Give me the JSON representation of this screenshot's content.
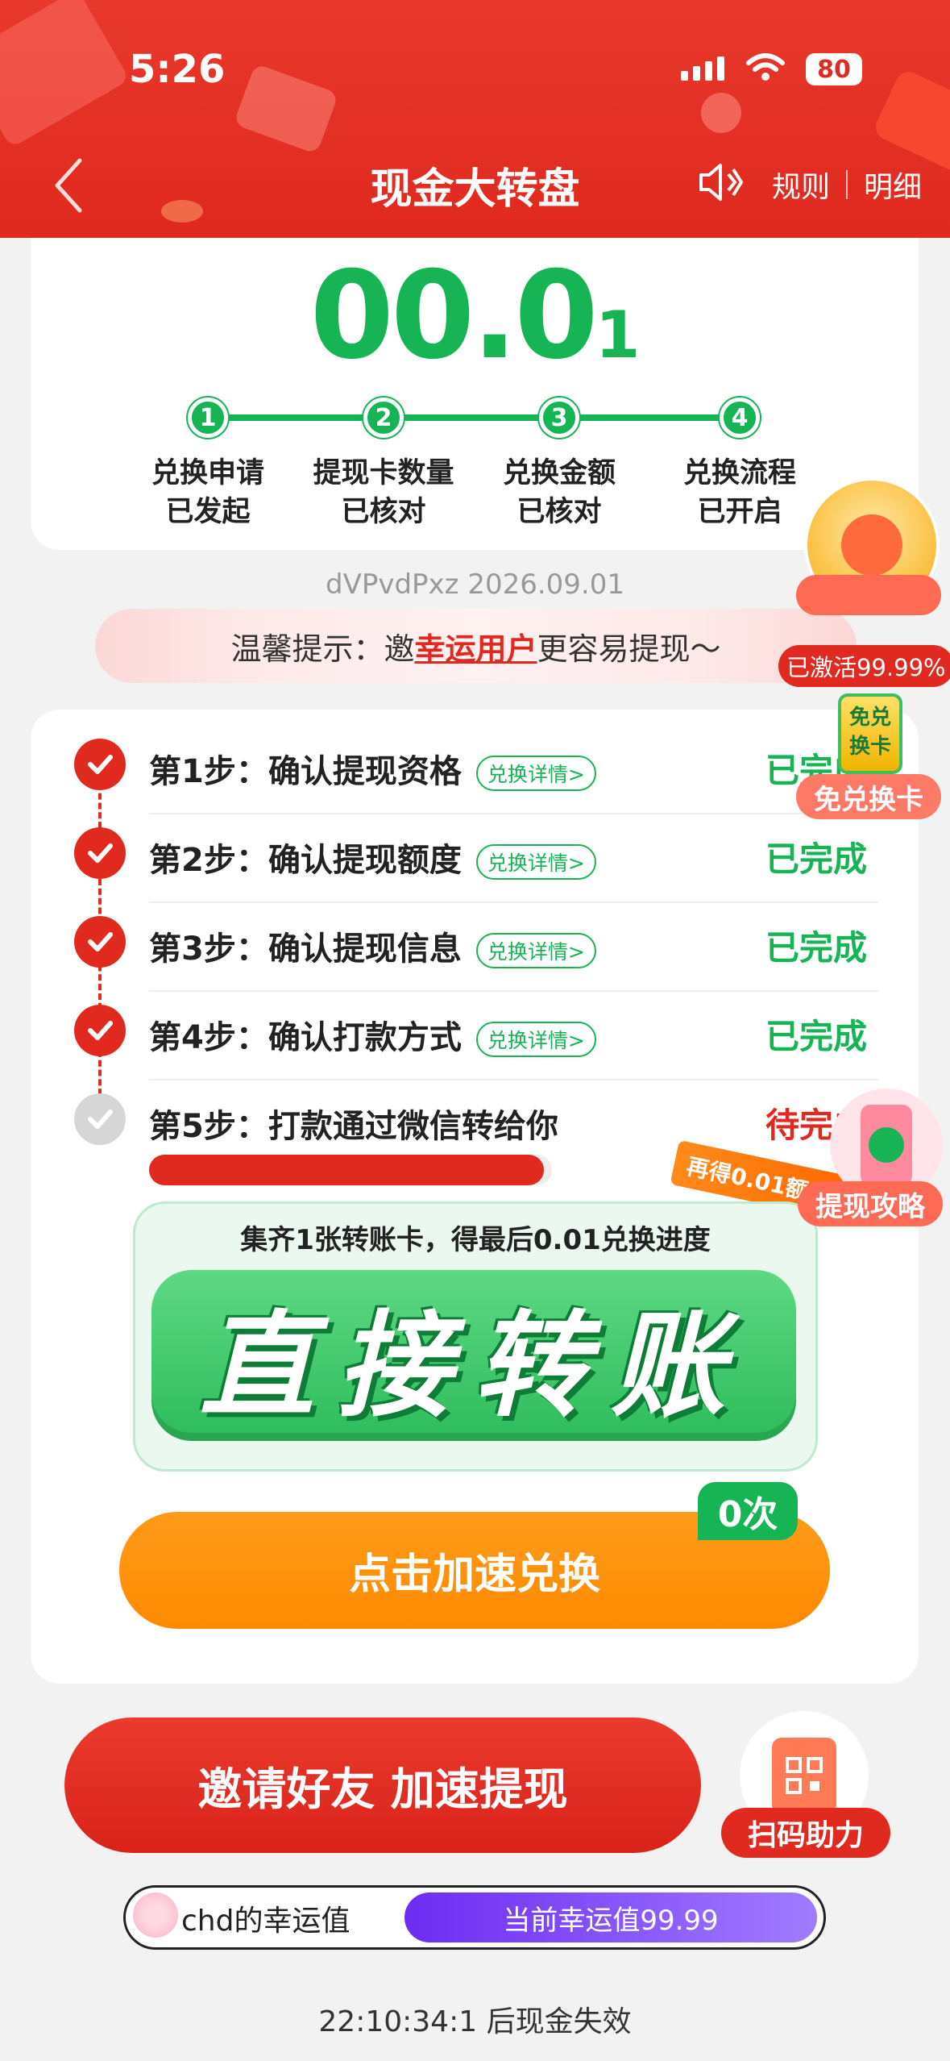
{
  "status_bar": {
    "time": "5:26",
    "battery": "80"
  },
  "header": {
    "title": "现金大转盘",
    "rules": "规则",
    "details": "明细"
  },
  "amount": {
    "main": "00.0",
    "tail": "1"
  },
  "progress_steps": [
    {
      "num": "1",
      "line1": "兑换申请",
      "line2": "已发起"
    },
    {
      "num": "2",
      "line1": "提现卡数量",
      "line2": "已核对"
    },
    {
      "num": "3",
      "line1": "兑换金额",
      "line2": "已核对"
    },
    {
      "num": "4",
      "line1": "兑换流程",
      "line2": "已开启"
    }
  ],
  "code_line": "dVPvdPxz 2026.09.01",
  "tip": {
    "prefix": "温馨提示：邀",
    "highlight": "幸运用户",
    "suffix": "更容易提现～"
  },
  "steps": [
    {
      "text": "第1步：确认提现资格",
      "tag": "兑换详情>",
      "status": "已完成",
      "done": true
    },
    {
      "text": "第2步：确认提现额度",
      "tag": "兑换详情>",
      "status": "已完成",
      "done": true
    },
    {
      "text": "第3步：确认提现信息",
      "tag": "兑换详情>",
      "status": "已完成",
      "done": true
    },
    {
      "text": "第4步：确认打款方式",
      "tag": "兑换详情>",
      "status": "已完成",
      "done": true
    },
    {
      "text": "第5步：打款通过微信转给你",
      "tag": "",
      "status": "待完成",
      "done": false
    }
  ],
  "progress": {
    "fraction": 0.98
  },
  "bonus_tag": "再得0.01额度",
  "transfer": {
    "title": "集齐1张转账卡，得最后0.01兑换进度",
    "button": "直接转账"
  },
  "accelerate": {
    "count": "0次",
    "label": "点击加速兑换"
  },
  "invite": {
    "label": "邀请好友 加速提现"
  },
  "scan": {
    "label": "扫码助力"
  },
  "luck": {
    "label": "chd的幸运值",
    "value": "当前幸运值99.99"
  },
  "expire": "22:10:34:1 后现金失效",
  "side": {
    "activated": "已激活99.99%",
    "free_card": "免兑换卡",
    "free_card_icon": "免兑换卡",
    "guide": "提现攻略"
  },
  "colors": {
    "brand_red": "#e0291f",
    "green": "#16b455",
    "orange": "#ff8a00",
    "purple": "#6d2cf2"
  }
}
